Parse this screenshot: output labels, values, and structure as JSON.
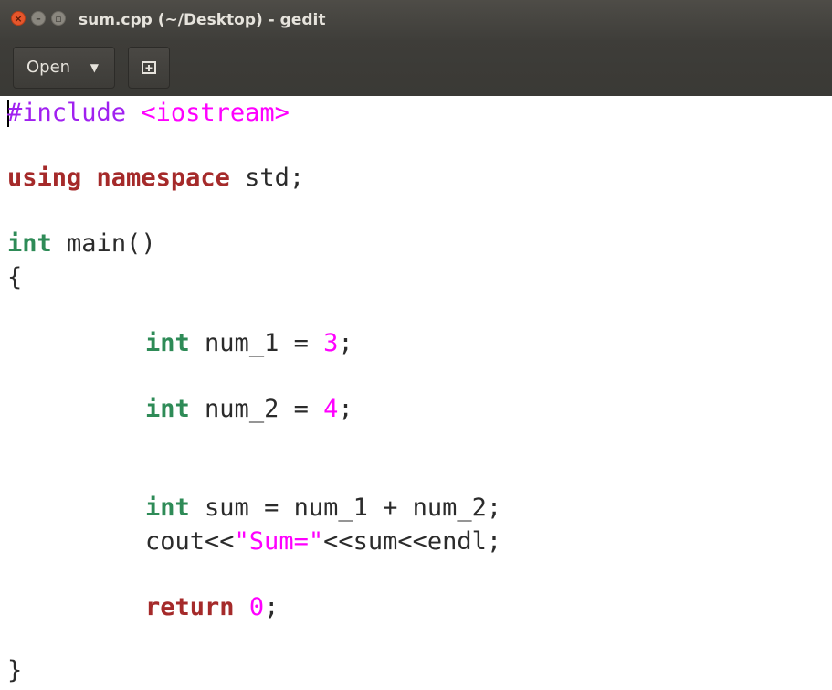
{
  "window": {
    "title": "sum.cpp (~/Desktop) - gedit"
  },
  "toolbar": {
    "open_label": "Open"
  },
  "icons": {
    "close": "close-icon",
    "minimize": "minimize-icon",
    "maximize": "maximize-icon",
    "caret": "chevron-down-icon",
    "new_tab": "new-tab-icon"
  },
  "colors": {
    "keyword_red": "#a52a2a",
    "keyword_type_green": "#2e8b57",
    "preprocessor": "#a020f0",
    "literal": "#ff00ff",
    "close_button": "#e5562c"
  },
  "code": {
    "line1": {
      "directive": "#include",
      "header": "<iostream>"
    },
    "line2": {
      "kw1": "using",
      "kw2": "namespace",
      "rest": "std;"
    },
    "line3": {
      "type": "int",
      "rest": "main()"
    },
    "line4": {
      "text": "{"
    },
    "line5": {
      "type": "int",
      "mid": "num_1 = ",
      "num": "3",
      "end": ";"
    },
    "line6": {
      "type": "int",
      "mid": "num_2 = ",
      "num": "4",
      "end": ";"
    },
    "line7": {
      "type": "int",
      "rest": "sum = num_1 + num_2;"
    },
    "line8": {
      "pre": "cout<<",
      "str": "\"Sum=\"",
      "post": "<<sum<<endl;"
    },
    "line9": {
      "kw": "return",
      "num": "0",
      "end": ";"
    },
    "line10": {
      "text": "}"
    }
  }
}
